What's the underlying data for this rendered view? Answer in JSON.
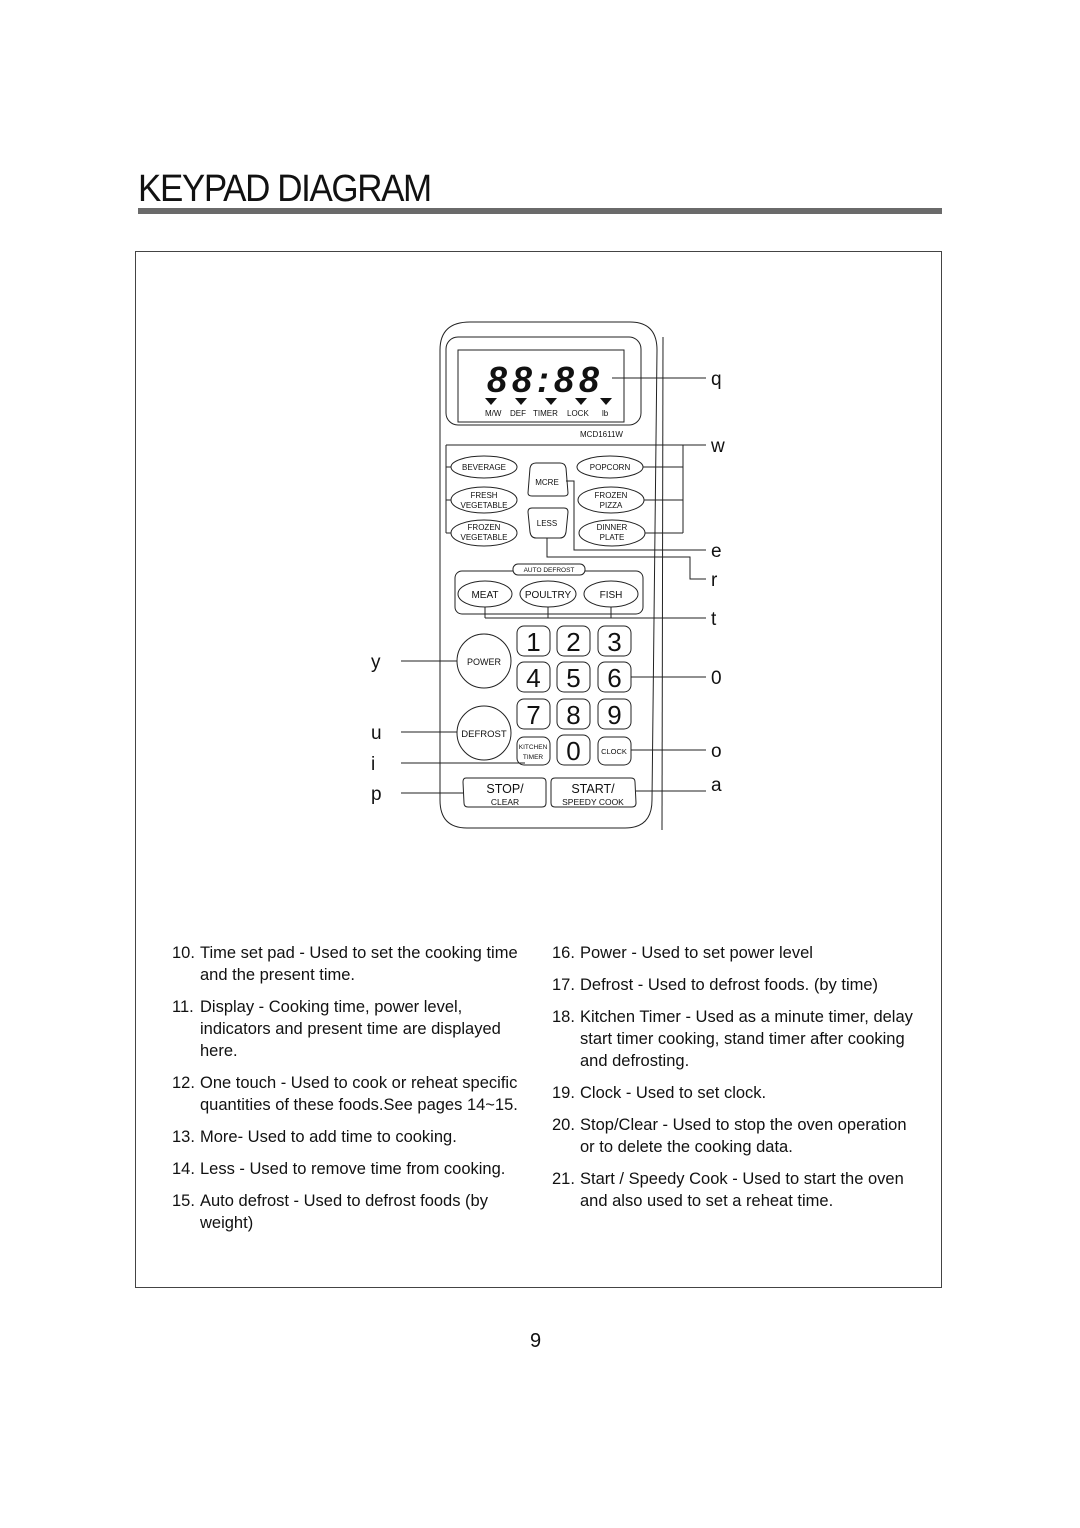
{
  "page": {
    "title": "KEYPAD DIAGRAM",
    "page_number": "9"
  },
  "display": {
    "digits": "88:88",
    "indicators": [
      "M/W",
      "DEF",
      "TIMER",
      "LOCK",
      "lb"
    ],
    "model": "MCD1611W"
  },
  "keys": {
    "beverage": "BEVERAGE",
    "fresh_vegetable": [
      "FRESH",
      "VEGETABLE"
    ],
    "frozen_vegetable": [
      "FROZEN",
      "VEGETABLE"
    ],
    "more": "MCRE",
    "less": "LESS",
    "popcorn": "POPCORN",
    "frozen_pizza": [
      "FROZEN",
      "PIZZA"
    ],
    "dinner_plate": [
      "DINNER",
      "PLATE"
    ],
    "auto_defrost_label": "AUTO DEFROST",
    "meat": "MEAT",
    "poultry": "POULTRY",
    "fish": "FISH",
    "power": "POWER",
    "defrost": "DEFROST",
    "digits": [
      "1",
      "2",
      "3",
      "4",
      "5",
      "6",
      "7",
      "8",
      "9",
      "0"
    ],
    "kitchen_timer": [
      "KITCHEN",
      "TIMER"
    ],
    "clock": "CLOCK",
    "stop": [
      "STOP/",
      "CLEAR"
    ],
    "start": [
      "START/",
      "SPEEDY COOK"
    ]
  },
  "callouts": {
    "q": "q",
    "w": "w",
    "e": "e",
    "r": "r",
    "t": "t",
    "zero": "0",
    "o": "o",
    "a": "a",
    "y": "y",
    "u": "u",
    "i": "i",
    "p": "p"
  },
  "descriptions_left": [
    {
      "num": "10.",
      "text": "Time set pad  - Used to set the cooking time and the present time."
    },
    {
      "num": "11.",
      "text": "Display  - Cooking time, power level, indicators and present time are displayed here."
    },
    {
      "num": "12.",
      "text": "One touch  - Used to cook or reheat specific quantities of these foods.See pages 14~15."
    },
    {
      "num": "13.",
      "text": " More- Used to add time to cooking."
    },
    {
      "num": "14.",
      "text": "Less  - Used to remove time from cooking."
    },
    {
      "num": "15.",
      "text": "Auto defrost  - Used to defrost foods (by weight)"
    }
  ],
  "descriptions_right": [
    {
      "num": "16.",
      "text": "Power  - Used to set power level"
    },
    {
      "num": "17.",
      "text": "Defrost  - Used to defrost foods. (by time)"
    },
    {
      "num": "18.",
      "text": " Kitchen Timer  - Used as a minute timer, delay start timer cooking, stand timer after cooking and defrosting."
    },
    {
      "num": "19.",
      "text": "Clock - Used to set clock."
    },
    {
      "num": "20.",
      "text": "Stop/Clear  - Used to stop the oven operation or to delete the cooking data."
    },
    {
      "num": "21.",
      "text": "Start / Speedy Cook  - Used to start the oven and also used to set a reheat time."
    }
  ]
}
